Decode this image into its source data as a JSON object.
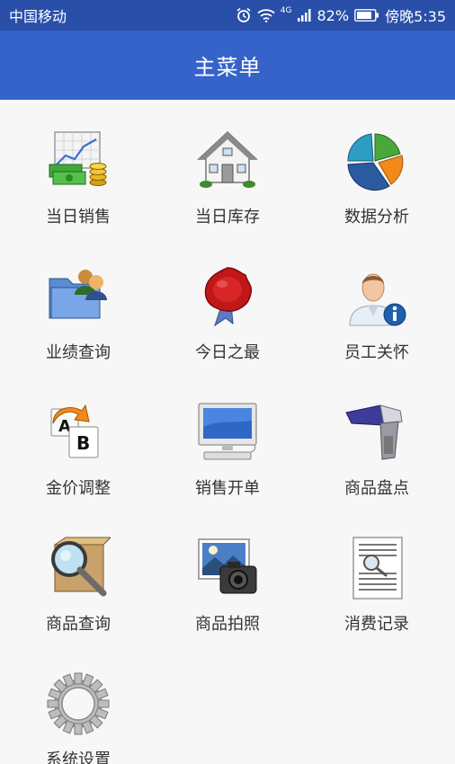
{
  "status_bar": {
    "carrier": "中国移动",
    "network": "4G",
    "battery": "82%",
    "time": "傍晚5:35"
  },
  "app_bar": {
    "title": "主菜单"
  },
  "menu": [
    {
      "label": "当日销售",
      "icon": "sales-chart-money-icon"
    },
    {
      "label": "当日库存",
      "icon": "house-icon"
    },
    {
      "label": "数据分析",
      "icon": "pie-chart-icon"
    },
    {
      "label": "业绩查询",
      "icon": "folder-users-icon"
    },
    {
      "label": "今日之最",
      "icon": "award-seal-icon"
    },
    {
      "label": "员工关怀",
      "icon": "employee-info-icon"
    },
    {
      "label": "金价调整",
      "icon": "a-to-b-icon"
    },
    {
      "label": "销售开单",
      "icon": "computer-icon"
    },
    {
      "label": "商品盘点",
      "icon": "barcode-scanner-icon"
    },
    {
      "label": "商品查询",
      "icon": "box-magnifier-icon"
    },
    {
      "label": "商品拍照",
      "icon": "camera-photo-icon"
    },
    {
      "label": "消费记录",
      "icon": "document-search-icon"
    },
    {
      "label": "系统设置",
      "icon": "gear-icon"
    }
  ]
}
